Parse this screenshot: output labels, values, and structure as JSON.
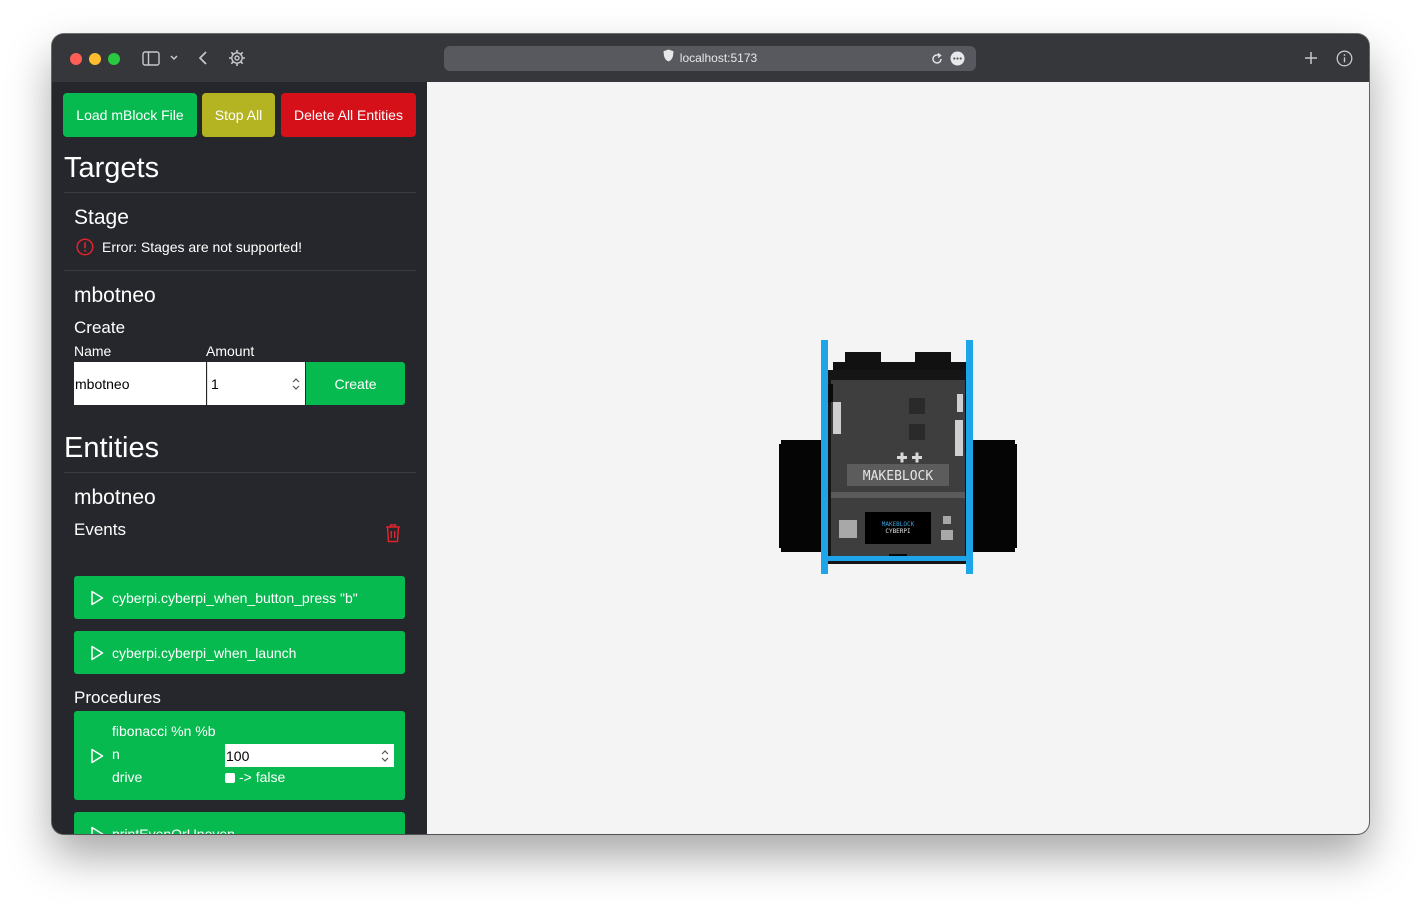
{
  "browser": {
    "url": "localhost:5173"
  },
  "toolbar": {
    "load_label": "Load mBlock File",
    "stop_label": "Stop All",
    "delete_label": "Delete All Entities"
  },
  "targets": {
    "heading": "Targets",
    "stage": {
      "title": "Stage",
      "error": "Error: Stages are not supported!"
    },
    "sprite": {
      "title": "mbotneo",
      "create_heading": "Create",
      "name_label": "Name",
      "amount_label": "Amount",
      "name_value": "mbotneo",
      "amount_value": "1",
      "create_label": "Create"
    }
  },
  "entities": {
    "heading": "Entities",
    "entity": {
      "title": "mbotneo",
      "events_heading": "Events",
      "events": [
        "cyberpi.cyberpi_when_button_press \"b\"",
        "cyberpi.cyberpi_when_launch"
      ],
      "procedures_heading": "Procedures",
      "procedure": {
        "name": "fibonacci %n %b",
        "param_n_label": "n",
        "param_n_value": "100",
        "param_drive_label": "drive",
        "param_drive_text": "-> false"
      },
      "procedure2": "printEvenOrUneven"
    }
  },
  "stage_sprite": {
    "brand": "MAKEBLOCK",
    "screen_line1": "MAKEBLOCK",
    "screen_line2": "CYBERPI"
  },
  "colors": {
    "green": "#07ba4f",
    "olive": "#b4b422",
    "red": "#d61018",
    "sidebar": "#25272c",
    "stage": "#f4f4f4"
  },
  "icons": [
    "sidebar-toggle-icon",
    "chevron-down-icon",
    "back-arrow-icon",
    "gear-icon",
    "shield-icon",
    "reload-icon",
    "more-icon",
    "plus-icon",
    "info-icon",
    "error-circle-icon",
    "trash-icon",
    "play-icon"
  ]
}
